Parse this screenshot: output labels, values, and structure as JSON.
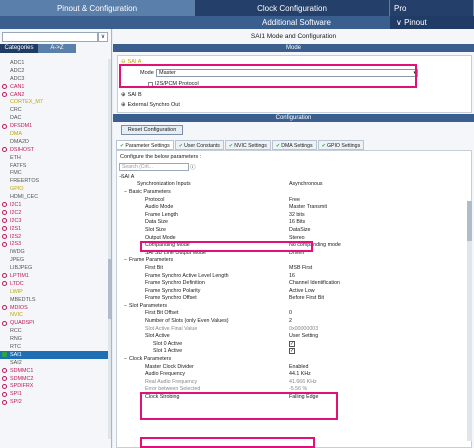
{
  "top_tabs": [
    "Pinout & Configuration",
    "Clock Configuration",
    "Pro"
  ],
  "sub_bar": {
    "additional_software": "Additional Software",
    "pinout": "∨ Pinout"
  },
  "left": {
    "search_placeholder": "",
    "search_dropdown": "∨",
    "categories_tab": "Categories",
    "az_tab": "A->Z",
    "items": [
      {
        "label": "ADC1",
        "color": "gray",
        "icon": "none"
      },
      {
        "label": "ADC2",
        "color": "gray",
        "icon": "none"
      },
      {
        "label": "ADC3",
        "color": "gray",
        "icon": "none"
      },
      {
        "label": "CAN1",
        "color": "pink",
        "icon": "warning"
      },
      {
        "label": "CAN2",
        "color": "pink",
        "icon": "warning"
      },
      {
        "label": "CORTEX_M7",
        "color": "yellow",
        "icon": "none"
      },
      {
        "label": "CRC",
        "color": "gray",
        "icon": "none"
      },
      {
        "label": "DAC",
        "color": "gray",
        "icon": "none"
      },
      {
        "label": "DFSDM1",
        "color": "pink",
        "icon": "warning"
      },
      {
        "label": "DMA",
        "color": "yellow",
        "icon": "none"
      },
      {
        "label": "DMA2D",
        "color": "gray",
        "icon": "none"
      },
      {
        "label": "DSIHOST",
        "color": "pink",
        "icon": "warning"
      },
      {
        "label": "ETH",
        "color": "gray",
        "icon": "none"
      },
      {
        "label": "FATFS",
        "color": "gray",
        "icon": "none"
      },
      {
        "label": "FMC",
        "color": "gray",
        "icon": "none"
      },
      {
        "label": "FREERTOS",
        "color": "gray",
        "icon": "none"
      },
      {
        "label": "GPIO",
        "color": "yellow",
        "icon": "none"
      },
      {
        "label": "HDMI_CEC",
        "color": "gray",
        "icon": "none"
      },
      {
        "label": "I2C1",
        "color": "pink",
        "icon": "warning"
      },
      {
        "label": "I2C2",
        "color": "pink",
        "icon": "warning"
      },
      {
        "label": "I2C3",
        "color": "pink",
        "icon": "warning"
      },
      {
        "label": "I2S1",
        "color": "pink",
        "icon": "warning"
      },
      {
        "label": "I2S2",
        "color": "pink",
        "icon": "warning"
      },
      {
        "label": "I2S3",
        "color": "pink",
        "icon": "warning"
      },
      {
        "label": "IWDG",
        "color": "gray",
        "icon": "none"
      },
      {
        "label": "JPEG",
        "color": "gray",
        "icon": "none"
      },
      {
        "label": "LIBJPEG",
        "color": "gray",
        "icon": "none"
      },
      {
        "label": "LPTIM1",
        "color": "pink",
        "icon": "warning"
      },
      {
        "label": "LTDC",
        "color": "pink",
        "icon": "warning"
      },
      {
        "label": "LWIP",
        "color": "yellow",
        "icon": "none"
      },
      {
        "label": "MBEDTLS",
        "color": "gray",
        "icon": "none"
      },
      {
        "label": "MDIOS",
        "color": "pink",
        "icon": "warning"
      },
      {
        "label": "NVIC",
        "color": "yellow",
        "icon": "none"
      },
      {
        "label": "QUADSPI",
        "color": "pink",
        "icon": "warning"
      },
      {
        "label": "RCC",
        "color": "gray",
        "icon": "none"
      },
      {
        "label": "RNG",
        "color": "gray",
        "icon": "none"
      },
      {
        "label": "RTC",
        "color": "gray",
        "icon": "none"
      },
      {
        "label": "SAI1",
        "color": "selected",
        "icon": "check"
      },
      {
        "label": "SAI2",
        "color": "gray",
        "icon": "none"
      },
      {
        "label": "SDMMC1",
        "color": "pink",
        "icon": "warning"
      },
      {
        "label": "SDMMC2",
        "color": "pink",
        "icon": "warning"
      },
      {
        "label": "SPDIFRX",
        "color": "pink",
        "icon": "warning"
      },
      {
        "label": "SPI1",
        "color": "pink",
        "icon": "warning"
      },
      {
        "label": "SPI2",
        "color": "pink",
        "icon": "warning"
      }
    ]
  },
  "right": {
    "title": "SAI1 Mode and Configuration",
    "mode_header": "Mode",
    "sai_a_label": "SAI A",
    "mode_label": "Mode",
    "mode_value": "Master",
    "i2s_pcm_label": "I2S/PCM Protocol",
    "sai_b_label": "SAI B",
    "ext_sync_label": "External Synchro Out",
    "config_header": "Configuration",
    "reset_button": "Reset Configuration",
    "tabs": [
      {
        "label": "Parameter Settings",
        "active": true
      },
      {
        "label": "User Constants",
        "active": false
      },
      {
        "label": "NVIC Settings",
        "active": false
      },
      {
        "label": "DMA Settings",
        "active": false
      },
      {
        "label": "GPIO Settings",
        "active": false
      }
    ],
    "params_label": "Configure the below parameters :",
    "search_placeholder": "Search (Crtl...",
    "tree": [
      {
        "key": "SAI A",
        "value": "",
        "indent": 0,
        "type": "group"
      },
      {
        "key": "Synchronization Inputs",
        "value": "Asynchronous",
        "indent": 2,
        "type": "row"
      },
      {
        "key": "Basic Parameters",
        "value": "",
        "indent": 1,
        "type": "group"
      },
      {
        "key": "Protocol",
        "value": "Free",
        "indent": 3,
        "type": "row"
      },
      {
        "key": "Audio Mode",
        "value": "Master Transmit",
        "indent": 3,
        "type": "row"
      },
      {
        "key": "Frame Length",
        "value": "32 bits",
        "indent": 3,
        "type": "row"
      },
      {
        "key": "Data Size",
        "value": "16 Bits",
        "indent": 3,
        "type": "row"
      },
      {
        "key": "Slot Size",
        "value": "DataSize",
        "indent": 3,
        "type": "row"
      },
      {
        "key": "Output Mode",
        "value": "Stereo",
        "indent": 3,
        "type": "row"
      },
      {
        "key": "Companding Mode",
        "value": "No companding mode",
        "indent": 3,
        "type": "row"
      },
      {
        "key": "SAI SD Line Output Mode",
        "value": "Driven",
        "indent": 3,
        "type": "row"
      },
      {
        "key": "Frame Parameters",
        "value": "",
        "indent": 1,
        "type": "group"
      },
      {
        "key": "First Bit",
        "value": "MSB First",
        "indent": 3,
        "type": "row"
      },
      {
        "key": "Frame Synchro Active Level Length",
        "value": "16",
        "indent": 3,
        "type": "row"
      },
      {
        "key": "Frame Synchro Definition",
        "value": "Channel Identification",
        "indent": 3,
        "type": "row"
      },
      {
        "key": "Frame Synchro Polarity",
        "value": "Active Low",
        "indent": 3,
        "type": "row"
      },
      {
        "key": "Frame Synchro Offset",
        "value": "Before First Bit",
        "indent": 3,
        "type": "row"
      },
      {
        "key": "Slot Parameters",
        "value": "",
        "indent": 1,
        "type": "group"
      },
      {
        "key": "First Bit Offset",
        "value": "0",
        "indent": 3,
        "type": "row"
      },
      {
        "key": "Number of Slots (only Even Values)",
        "value": "2",
        "indent": 3,
        "type": "row"
      },
      {
        "key": "Slot Active Final Value",
        "value": "0x00000003",
        "indent": 3,
        "type": "rowgray"
      },
      {
        "key": "Slot Active",
        "value": "User Setting",
        "indent": 3,
        "type": "row"
      },
      {
        "key": "Slot 0 Active",
        "value": "",
        "indent": 4,
        "type": "check"
      },
      {
        "key": "Slot 1 Active",
        "value": "",
        "indent": 4,
        "type": "check"
      },
      {
        "key": "Clock Parameters",
        "value": "",
        "indent": 1,
        "type": "group"
      },
      {
        "key": "Master Clock Divider",
        "value": "Enabled",
        "indent": 3,
        "type": "row"
      },
      {
        "key": "Audio Frequency",
        "value": "44.1 KHz",
        "indent": 3,
        "type": "row"
      },
      {
        "key": "Real Audio Frequency",
        "value": "41.666 KHz",
        "indent": 3,
        "type": "rowgray"
      },
      {
        "key": "Error between Selected",
        "value": "-5.56 %",
        "indent": 3,
        "type": "rowgray"
      },
      {
        "key": "Clock Strobing",
        "value": "Falling Edge",
        "indent": 3,
        "type": "row"
      }
    ]
  },
  "colors": {
    "highlight": "#e0127a",
    "header_bg": "#1f3b66",
    "tab_active": "#5b7fab"
  }
}
